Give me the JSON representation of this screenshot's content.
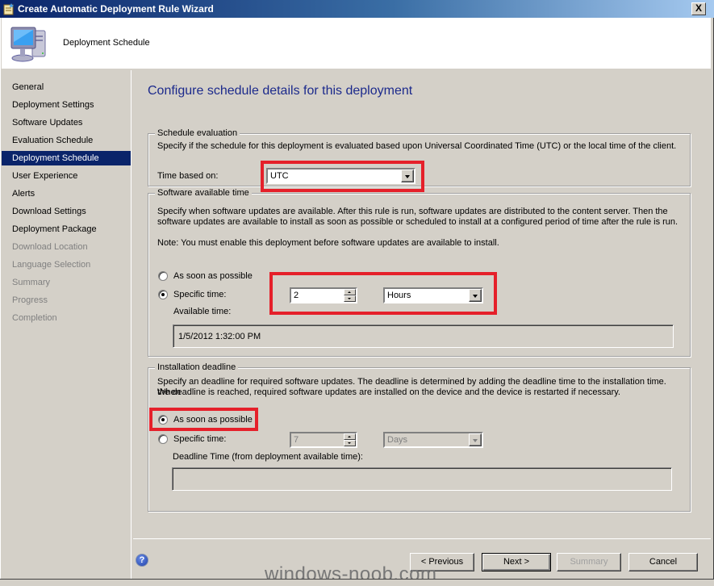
{
  "window": {
    "title": "Create Automatic Deployment Rule Wizard",
    "close_label": "X"
  },
  "header": {
    "title": "Deployment Schedule"
  },
  "sidebar": {
    "items": [
      {
        "label": "General",
        "state": "normal"
      },
      {
        "label": "Deployment Settings",
        "state": "normal"
      },
      {
        "label": "Software Updates",
        "state": "normal"
      },
      {
        "label": "Evaluation Schedule",
        "state": "normal"
      },
      {
        "label": "Deployment Schedule",
        "state": "active"
      },
      {
        "label": "User Experience",
        "state": "normal"
      },
      {
        "label": "Alerts",
        "state": "normal"
      },
      {
        "label": "Download Settings",
        "state": "normal"
      },
      {
        "label": "Deployment Package",
        "state": "normal"
      },
      {
        "label": "Download Location",
        "state": "disabled"
      },
      {
        "label": "Language Selection",
        "state": "disabled"
      },
      {
        "label": "Summary",
        "state": "disabled"
      },
      {
        "label": "Progress",
        "state": "disabled"
      },
      {
        "label": "Completion",
        "state": "disabled"
      }
    ]
  },
  "main": {
    "title": "Configure schedule details for this deployment",
    "schedule_evaluation": {
      "legend": "Schedule evaluation",
      "description": "Specify if the schedule for this deployment is evaluated based upon Universal Coordinated Time (UTC) or the local time of the client.",
      "time_based_on_label": "Time based on:",
      "time_based_on_value": "UTC"
    },
    "software_available_time": {
      "legend": "Software available time",
      "description_line1": "Specify when software updates are available. After this rule is run, software updates are distributed to the content server. Then the",
      "description_line2": "software updates are available to install as soon as possible or scheduled to install at a configured period of time after the rule is run.",
      "note": "Note: You must enable this deployment before software updates are available to install.",
      "asap_label": "As soon as possible",
      "specific_label": "Specific time:",
      "specific_checked": true,
      "amount": "2",
      "unit": "Hours",
      "available_time_label": "Available time:",
      "available_time_value": "1/5/2012 1:32:00 PM"
    },
    "installation_deadline": {
      "legend": "Installation deadline",
      "description_line1": "Specify an deadline for required software updates. The deadline is determined by adding the deadline time to the installation time. When",
      "description_line2": "the deadline is reached, required software updates are installed on the device and the device is restarted if necessary.",
      "asap_label": "As soon as possible",
      "asap_checked": true,
      "specific_label": "Specific time:",
      "amount": "7",
      "unit": "Days",
      "deadline_time_label": "Deadline Time (from deployment available time):",
      "deadline_time_value": ""
    }
  },
  "footer": {
    "help_label": "?",
    "previous_label": "< Previous",
    "next_label": "Next >",
    "summary_label": "Summary",
    "cancel_label": "Cancel"
  },
  "watermark": "windows-noob.com",
  "colors": {
    "highlight": "#e5202a",
    "active_nav": "#0a246a",
    "title_text": "#1c2a8c"
  }
}
